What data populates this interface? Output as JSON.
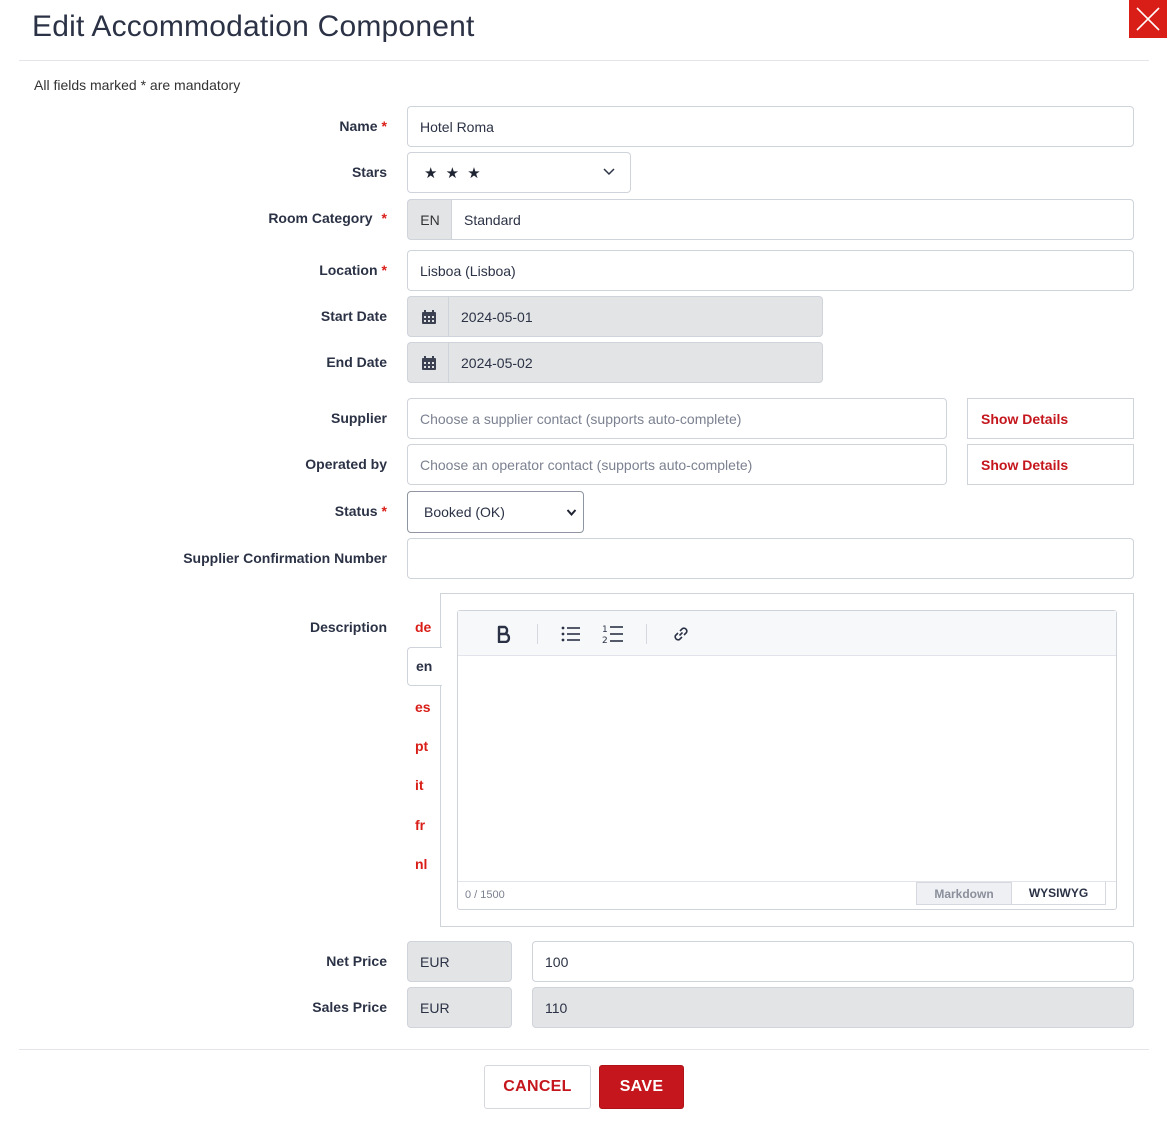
{
  "header": {
    "title": "Edit Accommodation Component"
  },
  "form": {
    "mandatory_note": "All fields marked * are mandatory",
    "required_mark": "*",
    "name": {
      "label": "Name",
      "value": "Hotel Roma"
    },
    "stars": {
      "label": "Stars",
      "value": 3,
      "display": "★ ★ ★"
    },
    "room_category": {
      "label": "Room Category",
      "lang": "EN",
      "value": "Standard"
    },
    "location": {
      "label": "Location",
      "value": "Lisboa (Lisboa)"
    },
    "start_date": {
      "label": "Start Date",
      "value": "2024-05-01"
    },
    "end_date": {
      "label": "End Date",
      "value": "2024-05-02"
    },
    "supplier": {
      "label": "Supplier",
      "placeholder": "Choose a supplier contact (supports auto-complete)",
      "details_label": "Show Details"
    },
    "operated_by": {
      "label": "Operated by",
      "placeholder": "Choose an operator contact (supports auto-complete)",
      "details_label": "Show Details"
    },
    "status": {
      "label": "Status",
      "value": "Booked (OK)"
    },
    "supplier_confirmation": {
      "label": "Supplier Confirmation Number",
      "value": ""
    },
    "description": {
      "label": "Description",
      "languages": [
        "de",
        "en",
        "es",
        "pt",
        "it",
        "fr",
        "nl"
      ],
      "active_language": "en",
      "char_count": "0 / 1500",
      "mode_tabs": [
        "Markdown",
        "WYSIWYG"
      ],
      "active_mode": "WYSIWYG"
    },
    "net_price": {
      "label": "Net Price",
      "currency": "EUR",
      "value": "100"
    },
    "sales_price": {
      "label": "Sales Price",
      "currency": "EUR",
      "value": "110"
    }
  },
  "footer": {
    "cancel_label": "CANCEL",
    "save_label": "SAVE"
  },
  "colors": {
    "accent": "#c4161c",
    "close": "#d91e18",
    "disabled_bg": "#e3e4e6"
  },
  "icons": [
    "close-icon",
    "chevron-down-icon",
    "calendar-icon",
    "bold-icon",
    "bullet-list-icon",
    "numbered-list-icon",
    "link-icon"
  ]
}
